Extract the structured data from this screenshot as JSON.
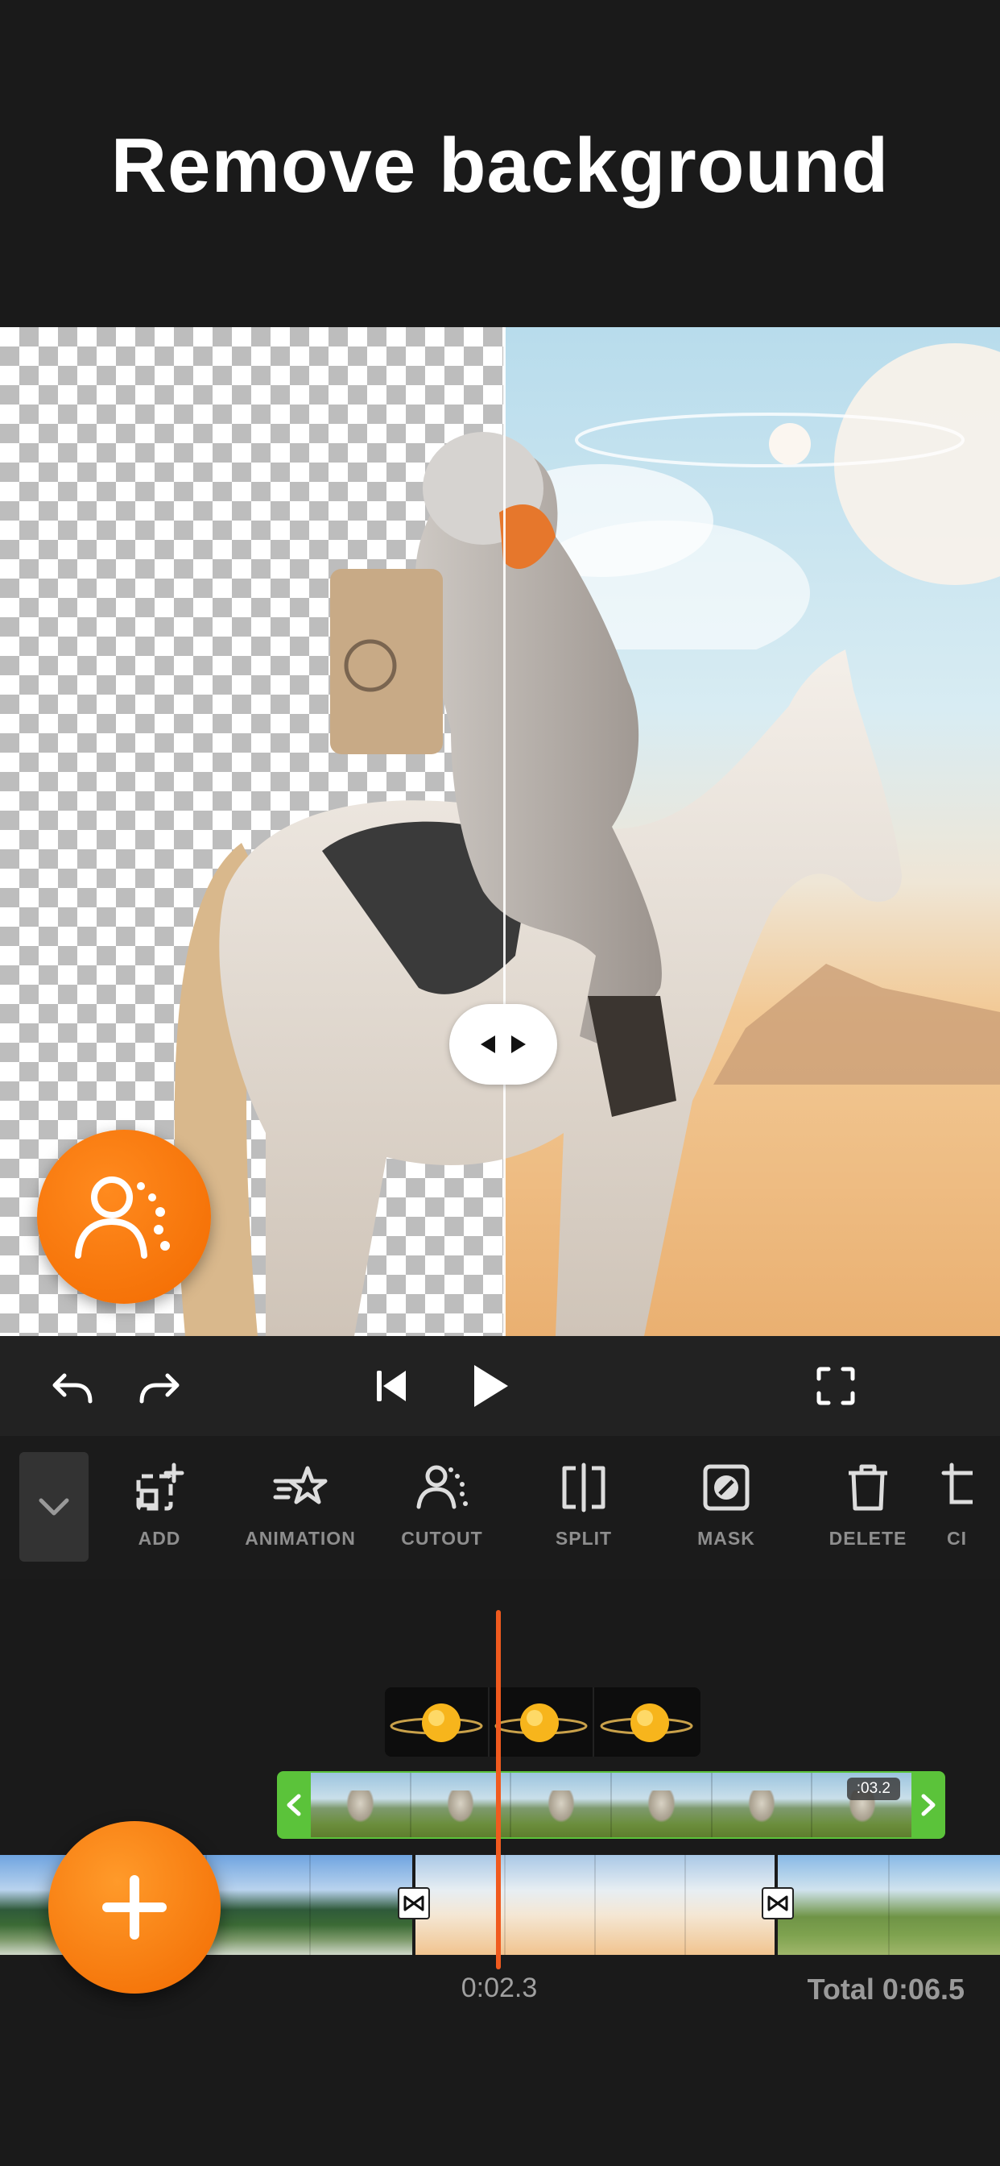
{
  "header": {
    "title": "Remove background"
  },
  "preview": {
    "split_handle_icon": "compare-arrows-icon",
    "cutout_fab_icon": "person-cutout-icon"
  },
  "controls": {
    "undo_icon": "undo-icon",
    "redo_icon": "redo-icon",
    "skip_start_icon": "skip-to-start-icon",
    "play_icon": "play-icon",
    "fullscreen_icon": "fullscreen-icon"
  },
  "toolbar": {
    "collapse_icon": "chevron-down-icon",
    "items": [
      {
        "label": "ADD",
        "icon": "add-layer-icon"
      },
      {
        "label": "ANIMATION",
        "icon": "animation-star-icon"
      },
      {
        "label": "CUTOUT",
        "icon": "cutout-person-icon"
      },
      {
        "label": "SPLIT",
        "icon": "split-icon"
      },
      {
        "label": "MASK",
        "icon": "mask-icon"
      },
      {
        "label": "DELETE",
        "icon": "trash-icon"
      },
      {
        "label": "CI",
        "icon": "crop-icon"
      }
    ]
  },
  "timeline": {
    "overlay_duration": ":03.2",
    "current_time": "0:02.3",
    "total_time": "Total 0:06.5",
    "add_icon": "plus-icon"
  }
}
